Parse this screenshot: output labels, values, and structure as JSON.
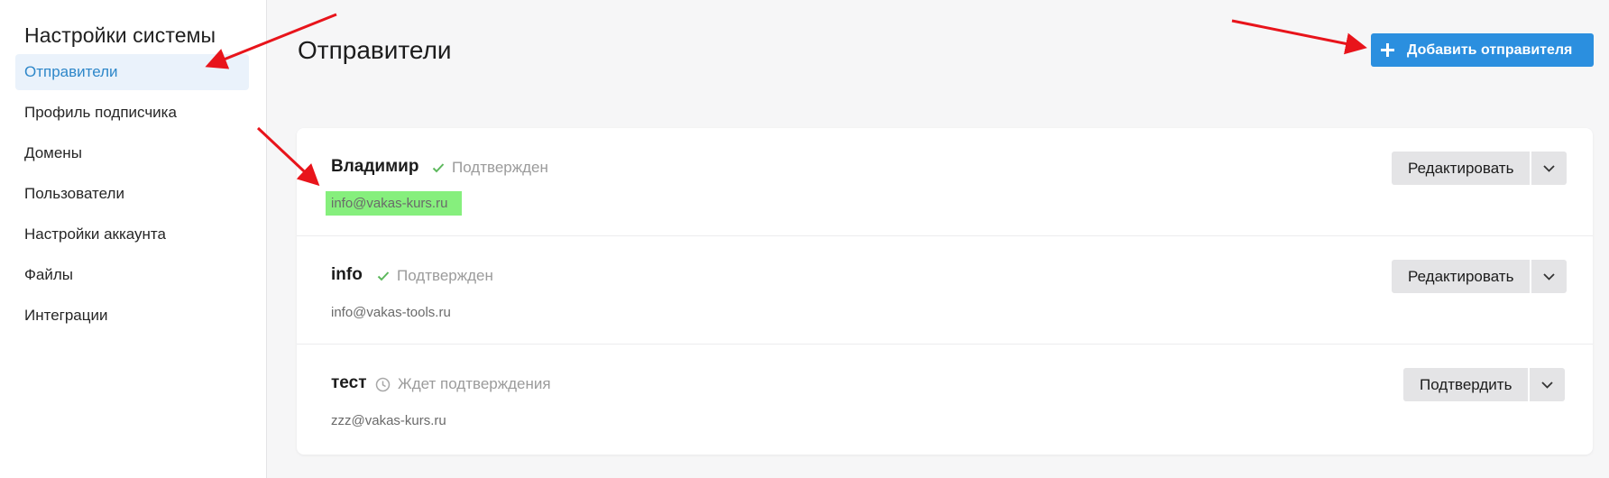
{
  "sidebar": {
    "title": "Настройки системы",
    "items": [
      {
        "label": "Отправители",
        "active": true
      },
      {
        "label": "Профиль подписчика"
      },
      {
        "label": "Домены"
      },
      {
        "label": "Пользователи"
      },
      {
        "label": "Настройки аккаунта"
      },
      {
        "label": "Файлы"
      },
      {
        "label": "Интеграции"
      }
    ]
  },
  "main": {
    "title": "Отправители",
    "add_button_label": "Добавить отправителя",
    "senders": [
      {
        "name": "Владимир",
        "status": "Подтвержден",
        "status_icon": "check-icon",
        "email": "info@vakas-kurs.ru",
        "action_label": "Редактировать"
      },
      {
        "name": "info",
        "status": "Подтвержден",
        "status_icon": "check-icon",
        "email": "info@vakas-tools.ru",
        "action_label": "Редактировать"
      },
      {
        "name": "тест",
        "status": "Ждет подтверждения",
        "status_icon": "clock-icon",
        "email": "zzz@vakas-kurs.ru",
        "action_label": "Подтвердить"
      }
    ]
  },
  "colors": {
    "accent": "#2b8fdf",
    "active_nav_bg": "#eaf2fb",
    "active_nav_text": "#2e87c9",
    "confirmed_check": "#5cb85c",
    "email_highlight": "#86ef7d",
    "annotation_arrow": "#e8141b"
  }
}
